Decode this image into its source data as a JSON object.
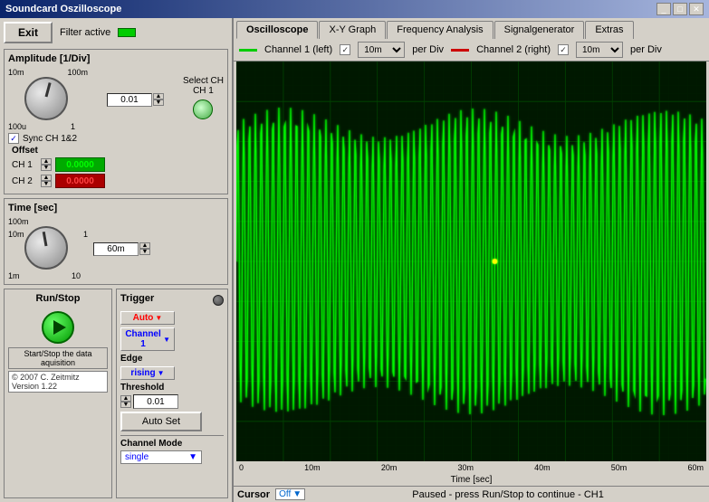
{
  "titleBar": {
    "title": "Soundcard Oszilloscope",
    "minBtn": "_",
    "maxBtn": "□",
    "closeBtn": "✕"
  },
  "leftPanel": {
    "exitBtn": "Exit",
    "filterLabel": "Filter active",
    "amplitude": {
      "title": "Amplitude [1/Div]",
      "labels": {
        "tl": "10m",
        "tr": "100m",
        "bl": "100u",
        "br": "1"
      },
      "valueDisplay": "0.01",
      "selectCH": "Select CH",
      "ch1Label": "CH 1",
      "syncLabel": "Sync CH 1&2",
      "offsetLabel": "Offset",
      "ch1OffsetLabel": "CH 1",
      "ch2OffsetLabel": "CH 2",
      "ch1OffsetValue": "0.0000",
      "ch2OffsetValue": "0.0000"
    },
    "time": {
      "title": "Time [sec]",
      "labels": {
        "tl": "100m",
        "tr": "",
        "bl": "1m",
        "br": "10"
      },
      "labelLeft": "10m",
      "labelRight": "1",
      "valueDisplay": "60m"
    },
    "runStop": {
      "title": "Run/Stop",
      "startStopLabel": "Start/Stop the data aquisition"
    },
    "trigger": {
      "title": "Trigger",
      "modeBtn": "Auto",
      "channelBtn": "Channel 1",
      "edgeLabel": "Edge",
      "edgeBtn": "rising",
      "thresholdLabel": "Threshold",
      "thresholdValue": "0.01",
      "autoSetBtn": "Auto Set",
      "channelModeLabel": "Channel Mode",
      "channelModeValue": "single"
    },
    "copyright": "© 2007  C. Zeitmitz Version 1.22"
  },
  "rightPanel": {
    "tabs": [
      {
        "id": "oscilloscope",
        "label": "Oscilloscope",
        "active": true
      },
      {
        "id": "xy-graph",
        "label": "X-Y Graph",
        "active": false
      },
      {
        "id": "frequency",
        "label": "Frequency Analysis",
        "active": false
      },
      {
        "id": "signal-gen",
        "label": "Signalgenerator",
        "active": false
      },
      {
        "id": "extras",
        "label": "Extras",
        "active": false
      }
    ],
    "channelLegend": {
      "ch1Label": "Channel 1 (left)",
      "ch1PerDiv": "10m",
      "ch1PerDivLabel": "per Div",
      "ch2Label": "Channel 2 (right)",
      "ch2PerDiv": "10m",
      "ch2PerDivLabel": "per Div"
    },
    "xAxis": {
      "labels": [
        "0",
        "10m",
        "20m",
        "30m",
        "40m",
        "50m",
        "60m"
      ],
      "title": "Time [sec]"
    },
    "cursor": {
      "label": "Cursor",
      "value": "Off"
    },
    "statusText": "Paused - press Run/Stop to continue - CH1"
  }
}
